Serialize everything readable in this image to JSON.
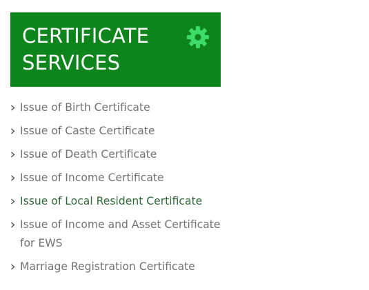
{
  "header": {
    "title_line1": "CERTIFICATE",
    "title_line2": "SERVICES",
    "icon": "gear-icon",
    "background_color": "#0e841c",
    "icon_color": "#3ddc6a"
  },
  "services": {
    "items": [
      {
        "label": "Issue of Birth Certificate"
      },
      {
        "label": "Issue of Caste Certificate"
      },
      {
        "label": "Issue of Death Certificate"
      },
      {
        "label": "Issue of Income Certificate"
      },
      {
        "label": "Issue of Local Resident Certificate",
        "active": true
      },
      {
        "label": "Issue of Income and Asset Certificate for EWS"
      },
      {
        "label": "Marriage Registration Certificate"
      }
    ],
    "bullet_icon": "chevron-right-icon",
    "text_color": "#737373",
    "active_color": "#2e6a39"
  }
}
